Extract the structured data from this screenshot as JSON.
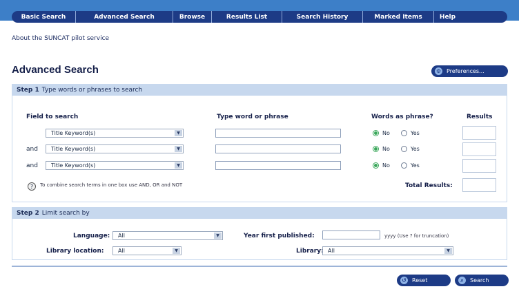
{
  "nav": {
    "items": [
      {
        "label": "Basic Search",
        "w": 93
      },
      {
        "label": "Advanced Search",
        "w": 141
      },
      {
        "label": "Browse",
        "w": 56
      },
      {
        "label": "Results List",
        "w": 102
      },
      {
        "label": "Search History",
        "w": 117
      },
      {
        "label": "Marked Items",
        "w": 103
      },
      {
        "label": "Help",
        "w": 39
      }
    ]
  },
  "about_link": "About the SUNCAT pilot service",
  "title": "Advanced Search",
  "preferences_label": "Preferences...",
  "step1": {
    "num": "Step 1",
    "text": "Type words or phrases to search",
    "headers": {
      "field": "Field to search",
      "phrase": "Type word or phrase",
      "as_phrase": "Words as phrase?",
      "results": "Results"
    },
    "rows": [
      {
        "connector": "",
        "field": "Title Keyword(s)",
        "value": "",
        "no": "No",
        "yes": "Yes"
      },
      {
        "connector": "and",
        "field": "Title Keyword(s)",
        "value": "",
        "no": "No",
        "yes": "Yes"
      },
      {
        "connector": "and",
        "field": "Title Keyword(s)",
        "value": "",
        "no": "No",
        "yes": "Yes"
      }
    ],
    "help_icon": "?",
    "help_text": "To combine search terms in one box use AND, OR and NOT",
    "total_results": "Total Results:"
  },
  "step2": {
    "num": "Step 2",
    "text": "Limit search by",
    "language_label": "Language:",
    "language_value": "All",
    "location_label": "Library location:",
    "location_value": "All",
    "year_label": "Year first published:",
    "year_value": "",
    "year_hint": "yyyy (Use ? for truncation)",
    "library_label": "Library:",
    "library_value": "All"
  },
  "buttons": {
    "reset": "Reset",
    "search": "Search"
  },
  "icons": {
    "preferences": "gear-icon",
    "reset": "reset-icon",
    "search": "magnifier-icon",
    "dropdown": "chevron-down-icon",
    "help": "question-icon"
  },
  "colors": {
    "topbar": "#3d7fc8",
    "navbar": "#1d3b86",
    "band": "#c7d8ee",
    "radio_selected": "#3aa75a"
  }
}
